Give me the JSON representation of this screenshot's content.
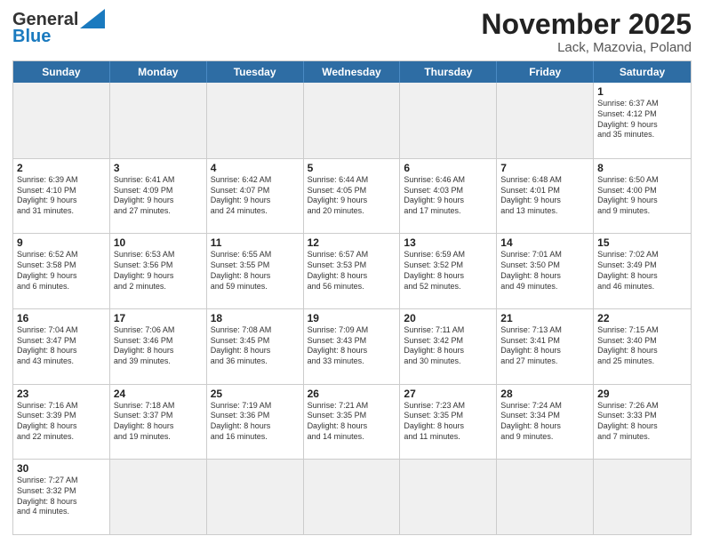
{
  "logo": {
    "general": "General",
    "blue": "Blue"
  },
  "title": "November 2025",
  "location": "Lack, Mazovia, Poland",
  "header_days": [
    "Sunday",
    "Monday",
    "Tuesday",
    "Wednesday",
    "Thursday",
    "Friday",
    "Saturday"
  ],
  "weeks": [
    [
      {
        "day": "",
        "info": "",
        "empty": true
      },
      {
        "day": "",
        "info": "",
        "empty": true
      },
      {
        "day": "",
        "info": "",
        "empty": true
      },
      {
        "day": "",
        "info": "",
        "empty": true
      },
      {
        "day": "",
        "info": "",
        "empty": true
      },
      {
        "day": "",
        "info": "",
        "empty": true
      },
      {
        "day": "1",
        "info": "Sunrise: 6:37 AM\nSunset: 4:12 PM\nDaylight: 9 hours\nand 35 minutes.",
        "empty": false
      }
    ],
    [
      {
        "day": "2",
        "info": "Sunrise: 6:39 AM\nSunset: 4:10 PM\nDaylight: 9 hours\nand 31 minutes.",
        "empty": false
      },
      {
        "day": "3",
        "info": "Sunrise: 6:41 AM\nSunset: 4:09 PM\nDaylight: 9 hours\nand 27 minutes.",
        "empty": false
      },
      {
        "day": "4",
        "info": "Sunrise: 6:42 AM\nSunset: 4:07 PM\nDaylight: 9 hours\nand 24 minutes.",
        "empty": false
      },
      {
        "day": "5",
        "info": "Sunrise: 6:44 AM\nSunset: 4:05 PM\nDaylight: 9 hours\nand 20 minutes.",
        "empty": false
      },
      {
        "day": "6",
        "info": "Sunrise: 6:46 AM\nSunset: 4:03 PM\nDaylight: 9 hours\nand 17 minutes.",
        "empty": false
      },
      {
        "day": "7",
        "info": "Sunrise: 6:48 AM\nSunset: 4:01 PM\nDaylight: 9 hours\nand 13 minutes.",
        "empty": false
      },
      {
        "day": "8",
        "info": "Sunrise: 6:50 AM\nSunset: 4:00 PM\nDaylight: 9 hours\nand 9 minutes.",
        "empty": false
      }
    ],
    [
      {
        "day": "9",
        "info": "Sunrise: 6:52 AM\nSunset: 3:58 PM\nDaylight: 9 hours\nand 6 minutes.",
        "empty": false
      },
      {
        "day": "10",
        "info": "Sunrise: 6:53 AM\nSunset: 3:56 PM\nDaylight: 9 hours\nand 2 minutes.",
        "empty": false
      },
      {
        "day": "11",
        "info": "Sunrise: 6:55 AM\nSunset: 3:55 PM\nDaylight: 8 hours\nand 59 minutes.",
        "empty": false
      },
      {
        "day": "12",
        "info": "Sunrise: 6:57 AM\nSunset: 3:53 PM\nDaylight: 8 hours\nand 56 minutes.",
        "empty": false
      },
      {
        "day": "13",
        "info": "Sunrise: 6:59 AM\nSunset: 3:52 PM\nDaylight: 8 hours\nand 52 minutes.",
        "empty": false
      },
      {
        "day": "14",
        "info": "Sunrise: 7:01 AM\nSunset: 3:50 PM\nDaylight: 8 hours\nand 49 minutes.",
        "empty": false
      },
      {
        "day": "15",
        "info": "Sunrise: 7:02 AM\nSunset: 3:49 PM\nDaylight: 8 hours\nand 46 minutes.",
        "empty": false
      }
    ],
    [
      {
        "day": "16",
        "info": "Sunrise: 7:04 AM\nSunset: 3:47 PM\nDaylight: 8 hours\nand 43 minutes.",
        "empty": false
      },
      {
        "day": "17",
        "info": "Sunrise: 7:06 AM\nSunset: 3:46 PM\nDaylight: 8 hours\nand 39 minutes.",
        "empty": false
      },
      {
        "day": "18",
        "info": "Sunrise: 7:08 AM\nSunset: 3:45 PM\nDaylight: 8 hours\nand 36 minutes.",
        "empty": false
      },
      {
        "day": "19",
        "info": "Sunrise: 7:09 AM\nSunset: 3:43 PM\nDaylight: 8 hours\nand 33 minutes.",
        "empty": false
      },
      {
        "day": "20",
        "info": "Sunrise: 7:11 AM\nSunset: 3:42 PM\nDaylight: 8 hours\nand 30 minutes.",
        "empty": false
      },
      {
        "day": "21",
        "info": "Sunrise: 7:13 AM\nSunset: 3:41 PM\nDaylight: 8 hours\nand 27 minutes.",
        "empty": false
      },
      {
        "day": "22",
        "info": "Sunrise: 7:15 AM\nSunset: 3:40 PM\nDaylight: 8 hours\nand 25 minutes.",
        "empty": false
      }
    ],
    [
      {
        "day": "23",
        "info": "Sunrise: 7:16 AM\nSunset: 3:39 PM\nDaylight: 8 hours\nand 22 minutes.",
        "empty": false
      },
      {
        "day": "24",
        "info": "Sunrise: 7:18 AM\nSunset: 3:37 PM\nDaylight: 8 hours\nand 19 minutes.",
        "empty": false
      },
      {
        "day": "25",
        "info": "Sunrise: 7:19 AM\nSunset: 3:36 PM\nDaylight: 8 hours\nand 16 minutes.",
        "empty": false
      },
      {
        "day": "26",
        "info": "Sunrise: 7:21 AM\nSunset: 3:35 PM\nDaylight: 8 hours\nand 14 minutes.",
        "empty": false
      },
      {
        "day": "27",
        "info": "Sunrise: 7:23 AM\nSunset: 3:35 PM\nDaylight: 8 hours\nand 11 minutes.",
        "empty": false
      },
      {
        "day": "28",
        "info": "Sunrise: 7:24 AM\nSunset: 3:34 PM\nDaylight: 8 hours\nand 9 minutes.",
        "empty": false
      },
      {
        "day": "29",
        "info": "Sunrise: 7:26 AM\nSunset: 3:33 PM\nDaylight: 8 hours\nand 7 minutes.",
        "empty": false
      }
    ],
    [
      {
        "day": "30",
        "info": "Sunrise: 7:27 AM\nSunset: 3:32 PM\nDaylight: 8 hours\nand 4 minutes.",
        "empty": false
      },
      {
        "day": "",
        "info": "",
        "empty": true
      },
      {
        "day": "",
        "info": "",
        "empty": true
      },
      {
        "day": "",
        "info": "",
        "empty": true
      },
      {
        "day": "",
        "info": "",
        "empty": true
      },
      {
        "day": "",
        "info": "",
        "empty": true
      },
      {
        "day": "",
        "info": "",
        "empty": true
      }
    ]
  ]
}
